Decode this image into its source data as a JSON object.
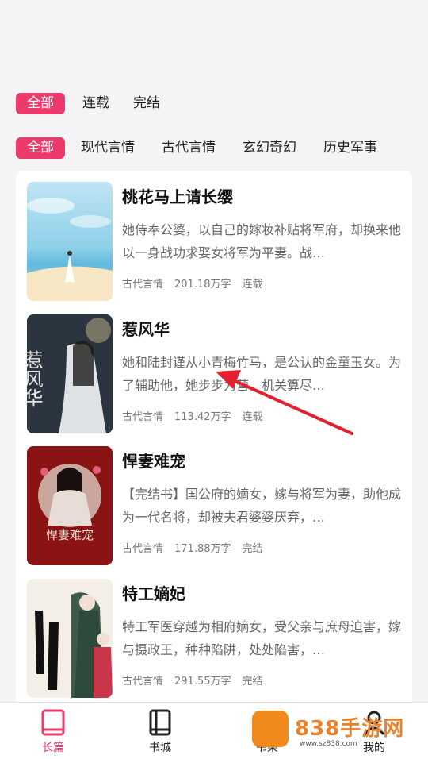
{
  "filters": {
    "status": [
      "全部",
      "连载",
      "完结"
    ],
    "genre": [
      "全部",
      "现代言情",
      "古代言情",
      "玄幻奇幻",
      "历史军事"
    ]
  },
  "books": [
    {
      "title": "桃花马上请长缨",
      "desc": "她侍奉公婆，以自己的嫁妆补贴将军府，却换来他以一身战功求娶女将军为平妻。战…",
      "genre": "古代言情",
      "words": "201.18万字",
      "status": "连载"
    },
    {
      "title": "惹风华",
      "desc": "她和陆封谨从小青梅竹马，是公认的金童玉女。为了辅助他，她步步为营，机关算尽…",
      "genre": "古代言情",
      "words": "113.42万字",
      "status": "连载"
    },
    {
      "title": "悍妻难宠",
      "desc": "【完结书】国公府的嫡女，嫁与将军为妻，助他成为一代名将，却被夫君婆婆厌弃，…",
      "genre": "古代言情",
      "words": "171.88万字",
      "status": "完结"
    },
    {
      "title": "特工嫡妃",
      "desc": "特工军医穿越为相府嫡女，受父亲与庶母迫害，嫁与摄政王，种种陷阱，处处陷害，…",
      "genre": "古代言情",
      "words": "291.55万字",
      "status": "完结"
    }
  ],
  "covers": {
    "book2_text": "惹风华",
    "book3_text": "悍妻难宠"
  },
  "tabs": [
    "长篇",
    "书城",
    "书架",
    "我的"
  ],
  "colors": {
    "accent": "#ec3b6a",
    "watermark": "#e9822a"
  },
  "watermark": {
    "text": "838手游网",
    "url": "www.sz838.com"
  }
}
